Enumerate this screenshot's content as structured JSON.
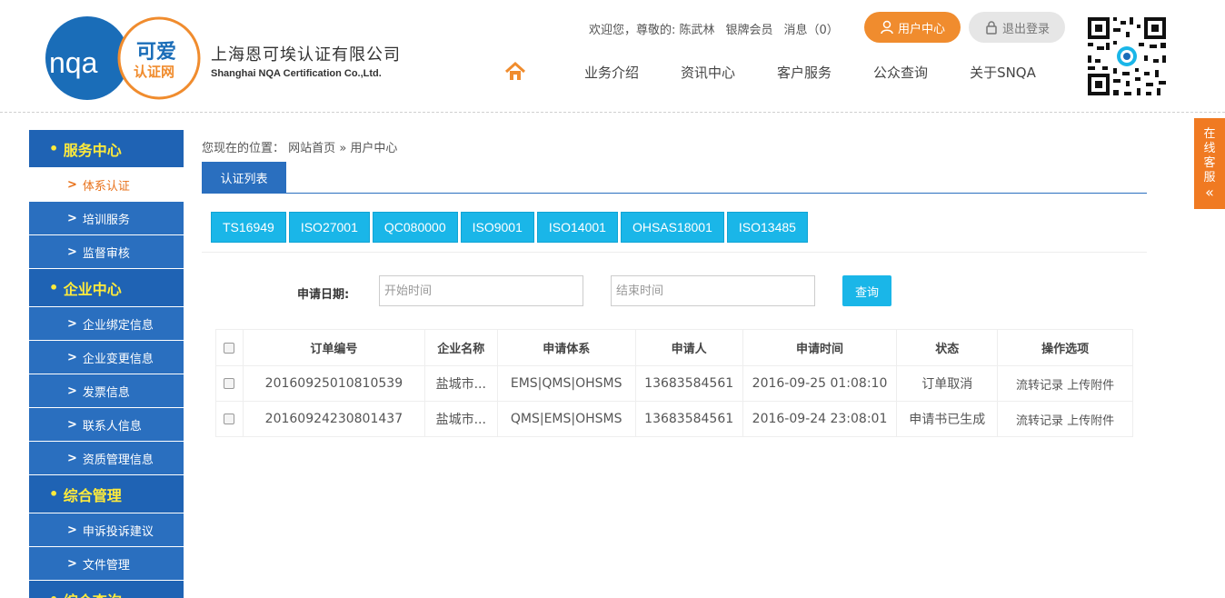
{
  "brand": {
    "logo_text": "nqa",
    "logo_badge_line1": "可爱",
    "logo_badge_line2": "认证网",
    "company_cn": "上海恩可埃认证有限公司",
    "company_en": "Shanghai NQA Certification Co.,Ltd."
  },
  "topbar": {
    "welcome": "欢迎您，尊敬的: 陈武林",
    "member": "银牌会员",
    "messages": "消息（0）",
    "user_center": "用户中心",
    "logout": "退出登录"
  },
  "nav": [
    "业务介绍",
    "资讯中心",
    "客户服务",
    "公众查询",
    "关于SNQA"
  ],
  "side_service": [
    "在",
    "线",
    "客",
    "服",
    "«"
  ],
  "sidebar": [
    {
      "type": "group",
      "label": "服务中心"
    },
    {
      "type": "sub",
      "label": "体系认证",
      "active": true
    },
    {
      "type": "sub",
      "label": "培训服务"
    },
    {
      "type": "sub",
      "label": "监督审核"
    },
    {
      "type": "group",
      "label": "企业中心"
    },
    {
      "type": "sub",
      "label": "企业绑定信息"
    },
    {
      "type": "sub",
      "label": "企业变更信息"
    },
    {
      "type": "sub",
      "label": "发票信息"
    },
    {
      "type": "sub",
      "label": "联系人信息"
    },
    {
      "type": "sub",
      "label": "资质管理信息"
    },
    {
      "type": "group",
      "label": "综合管理"
    },
    {
      "type": "sub",
      "label": "申诉投诉建议"
    },
    {
      "type": "sub",
      "label": "文件管理"
    },
    {
      "type": "group",
      "label": "综合查询"
    }
  ],
  "breadcrumb": {
    "prefix": "您现在的位置：",
    "home": "网站首页",
    "sep": "»",
    "current": "用户中心"
  },
  "tab": "认证列表",
  "standards": [
    "TS16949",
    "ISO27001",
    "QC080000",
    "ISO9001",
    "ISO14001",
    "OHSAS18001",
    "ISO13485"
  ],
  "filter": {
    "label": "申请日期:",
    "start_placeholder": "开始时间",
    "end_placeholder": "结束时间",
    "query": "查询"
  },
  "table": {
    "headers": [
      "订单编号",
      "企业名称",
      "申请体系",
      "申请人",
      "申请时间",
      "状态",
      "操作选项"
    ],
    "rows": [
      {
        "order": "20160925010810539",
        "company": "盐城市...",
        "system": "EMS|QMS|OHSMS",
        "applicant": "13683584561",
        "time": "2016-09-25 01:08:10",
        "status": "订单取消",
        "op1": "流转记录",
        "op2": "上传附件"
      },
      {
        "order": "20160924230801437",
        "company": "盐城市...",
        "system": "QMS|EMS|OHSMS",
        "applicant": "13683584561",
        "time": "2016-09-24 23:08:01",
        "status": "申请书已生成",
        "op1": "流转记录",
        "op2": "上传附件"
      }
    ]
  },
  "colors": {
    "nav_blue": "#2a6fbf",
    "group_blue": "#1f63b4",
    "accent_orange": "#f08c2e",
    "cyan": "#1ab6e8",
    "yellow": "#ffeb3b"
  }
}
